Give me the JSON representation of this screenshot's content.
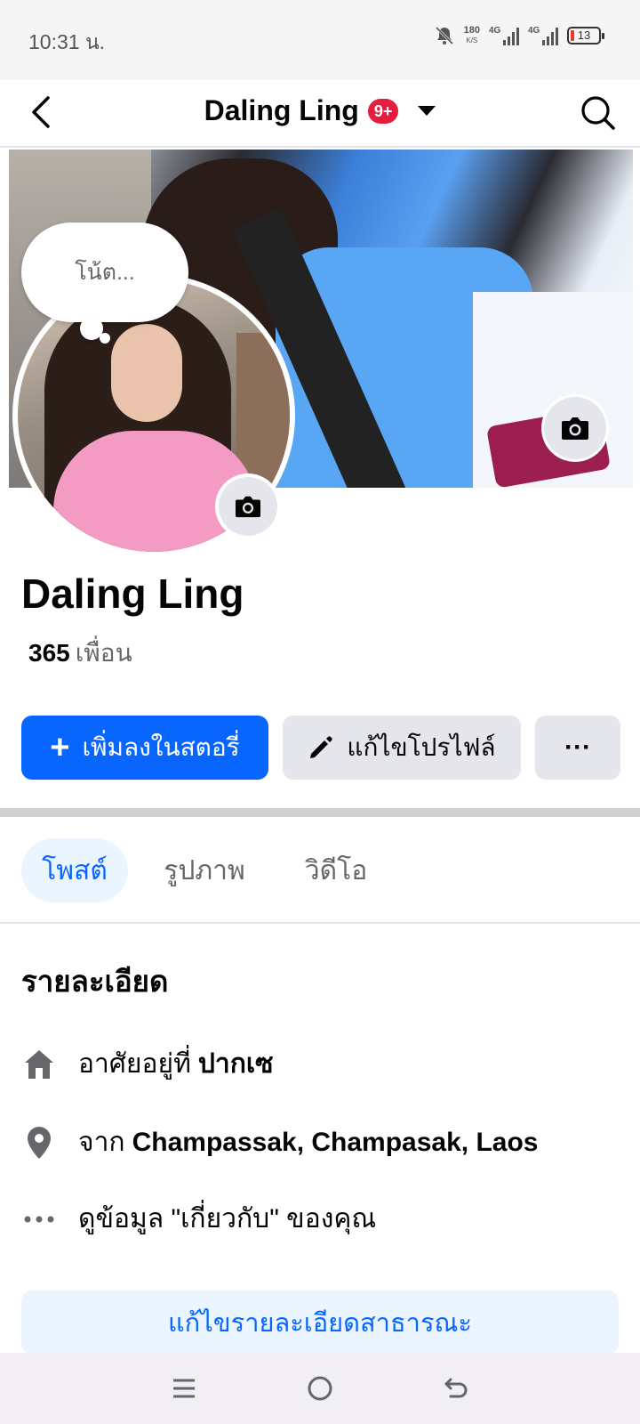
{
  "status_bar": {
    "time": "10:31 น.",
    "net_speed": "180",
    "net_unit": "K/S",
    "signal1": "4G",
    "signal2": "4G",
    "battery": "13"
  },
  "navbar": {
    "title": "Daling Ling",
    "badge": "9+"
  },
  "note": {
    "placeholder": "โน้ต..."
  },
  "profile": {
    "name": "Daling Ling",
    "friends_count": "365",
    "friends_label": "เพื่อน"
  },
  "actions": {
    "add_story": "เพิ่มลงในสตอรี่",
    "edit_profile": "แก้ไขโปรไฟล์",
    "more": "···"
  },
  "tabs": [
    {
      "label": "โพสต์",
      "active": true
    },
    {
      "label": "รูปภาพ",
      "active": false
    },
    {
      "label": "วิดีโอ",
      "active": false
    }
  ],
  "details": {
    "title": "รายละเอียด",
    "lives_prefix": "อาศัยอยู่ที่",
    "lives_value": "ปากเซ",
    "from_prefix": "จาก",
    "from_value": "Champassak, Champasak, Laos",
    "about_link": "ดูข้อมูล \"เกี่ยวกับ\" ของคุณ",
    "edit_button": "แก้ไขรายละเอียดสาธารณะ"
  },
  "colors": {
    "primary": "#0866ff",
    "badge": "#e41e3f",
    "secondary_button": "#e4e6eb",
    "tab_active_bg": "#ebf5ff"
  }
}
